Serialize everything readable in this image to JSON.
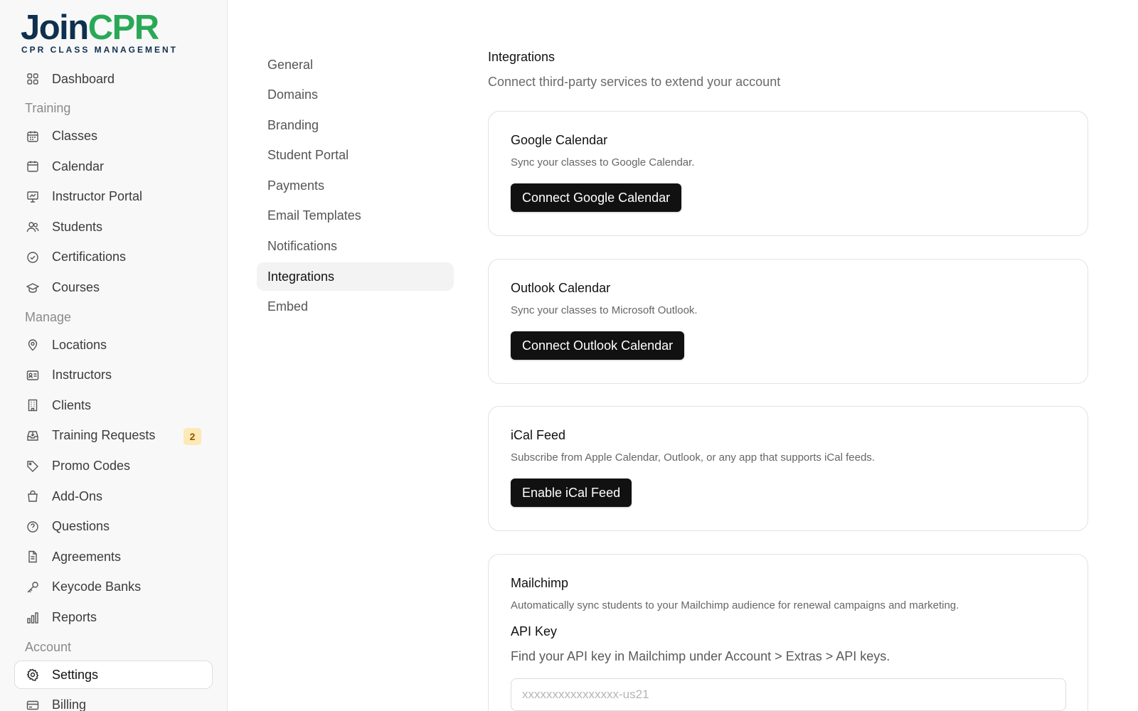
{
  "brand": {
    "name_part1": "Join",
    "name_part2": "CPR",
    "tagline": "CPR CLASS MANAGEMENT",
    "color_dark": "#0f2f4e",
    "color_accent": "#29a957"
  },
  "sidebar": {
    "top": [
      {
        "label": "Dashboard",
        "icon": "grid-icon"
      }
    ],
    "sections": [
      {
        "label": "Training",
        "items": [
          {
            "label": "Classes",
            "icon": "calendar-grid-icon"
          },
          {
            "label": "Calendar",
            "icon": "calendar-icon"
          },
          {
            "label": "Instructor Portal",
            "icon": "presentation-icon"
          },
          {
            "label": "Students",
            "icon": "users-icon"
          },
          {
            "label": "Certifications",
            "icon": "check-circle-icon"
          },
          {
            "label": "Courses",
            "icon": "graduation-cap-icon"
          }
        ]
      },
      {
        "label": "Manage",
        "items": [
          {
            "label": "Locations",
            "icon": "map-pin-icon"
          },
          {
            "label": "Instructors",
            "icon": "id-card-icon"
          },
          {
            "label": "Clients",
            "icon": "building-icon"
          },
          {
            "label": "Training Requests",
            "icon": "inbox-icon",
            "badge": "2"
          },
          {
            "label": "Promo Codes",
            "icon": "tag-icon"
          },
          {
            "label": "Add-Ons",
            "icon": "shopping-bag-icon"
          },
          {
            "label": "Questions",
            "icon": "help-circle-icon"
          },
          {
            "label": "Agreements",
            "icon": "file-icon"
          },
          {
            "label": "Keycode Banks",
            "icon": "key-icon"
          },
          {
            "label": "Reports",
            "icon": "bar-chart-icon"
          }
        ]
      },
      {
        "label": "Account",
        "items": [
          {
            "label": "Settings",
            "icon": "gear-icon",
            "active": true
          },
          {
            "label": "Billing",
            "icon": "credit-card-icon"
          }
        ]
      }
    ]
  },
  "settings_nav": {
    "items": [
      {
        "label": "General"
      },
      {
        "label": "Domains"
      },
      {
        "label": "Branding"
      },
      {
        "label": "Student Portal"
      },
      {
        "label": "Payments"
      },
      {
        "label": "Email Templates"
      },
      {
        "label": "Notifications"
      },
      {
        "label": "Integrations",
        "active": true
      },
      {
        "label": "Embed"
      }
    ]
  },
  "main": {
    "title": "Integrations",
    "description": "Connect third-party services to extend your account",
    "cards": [
      {
        "title": "Google Calendar",
        "description": "Sync your classes to Google Calendar.",
        "button": "Connect Google Calendar"
      },
      {
        "title": "Outlook Calendar",
        "description": "Sync your classes to Microsoft Outlook.",
        "button": "Connect Outlook Calendar"
      },
      {
        "title": "iCal Feed",
        "description": "Subscribe from Apple Calendar, Outlook, or any app that supports iCal feeds.",
        "button": "Enable iCal Feed"
      },
      {
        "title": "Mailchimp",
        "description": "Automatically sync students to your Mailchimp audience for renewal campaigns and marketing.",
        "field_label": "API Key",
        "field_help": "Find your API key in Mailchimp under Account > Extras > API keys.",
        "field_placeholder": "xxxxxxxxxxxxxxxx-us21",
        "field_value": ""
      }
    ]
  }
}
